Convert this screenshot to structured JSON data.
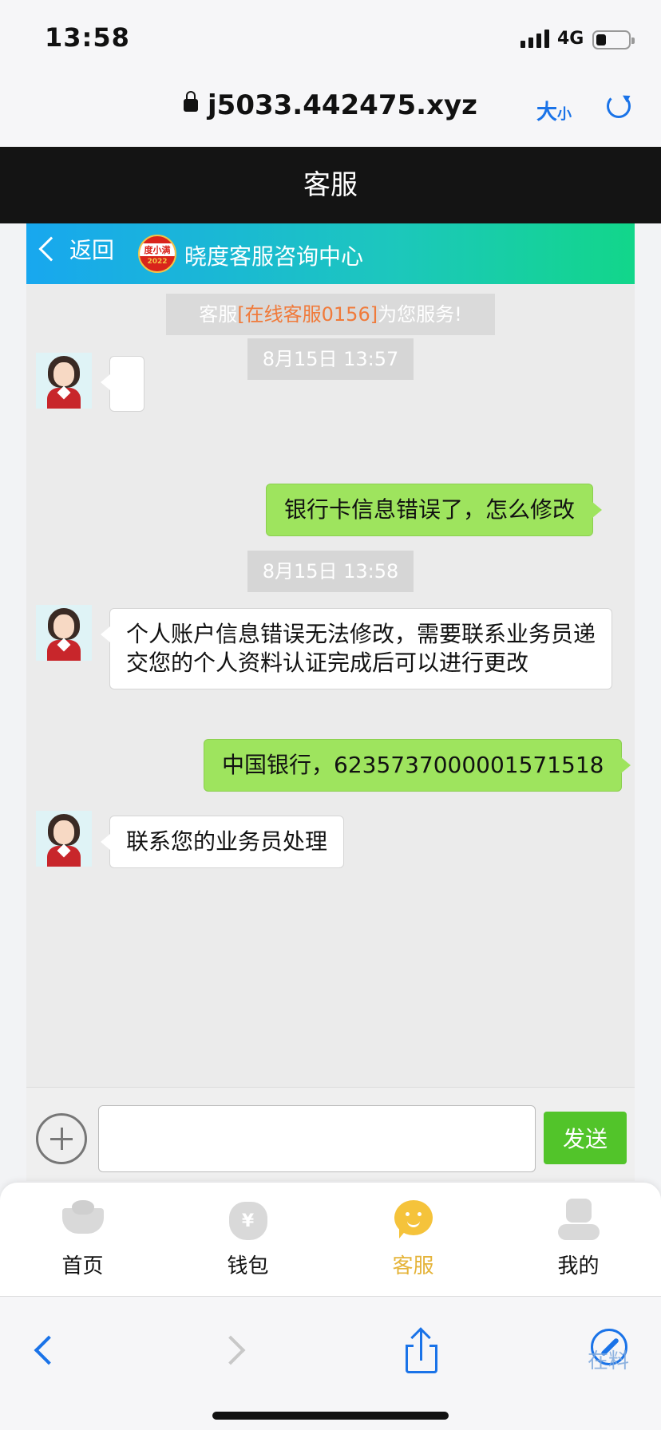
{
  "status_bar": {
    "time": "13:58",
    "network": "4G"
  },
  "browser": {
    "url": "j5033.442475.xyz",
    "text_size_big": "大",
    "text_size_small": "小"
  },
  "page_title": "客服",
  "chat_header": {
    "back_label": "返回",
    "logo_top": "度小满",
    "logo_bottom": "2022",
    "title": "晓度客服咨询中心"
  },
  "notice": {
    "prefix": "客服",
    "agent": "[在线客服0156]",
    "suffix": "为您服务!"
  },
  "messages": {
    "ts1": "8月15日 13:57",
    "m1": "",
    "m2": "银行卡信息错误了，怎么修改",
    "ts2": "8月15日 13:58",
    "m3": "个人账户信息错误无法修改，需要联系业务员递交您的个人资料认证完成后可以进行更改",
    "m4": "中国银行，6235737000001571518",
    "m5": "联系您的业务员处理"
  },
  "composer": {
    "value": "",
    "send_label": "发送"
  },
  "tabs": [
    {
      "label": "首页",
      "icon": "home-ingot-icon"
    },
    {
      "label": "钱包",
      "icon": "wallet-bag-icon"
    },
    {
      "label": "客服",
      "icon": "service-chat-icon",
      "active": true
    },
    {
      "label": "我的",
      "icon": "profile-icon"
    }
  ],
  "watermark": "在料",
  "colors": {
    "accent_green": "#52c42a",
    "bubble_green": "#9ee45e",
    "tab_active": "#e5b43a",
    "link_blue": "#1a73e8",
    "agent_orange": "#f07a3a"
  }
}
